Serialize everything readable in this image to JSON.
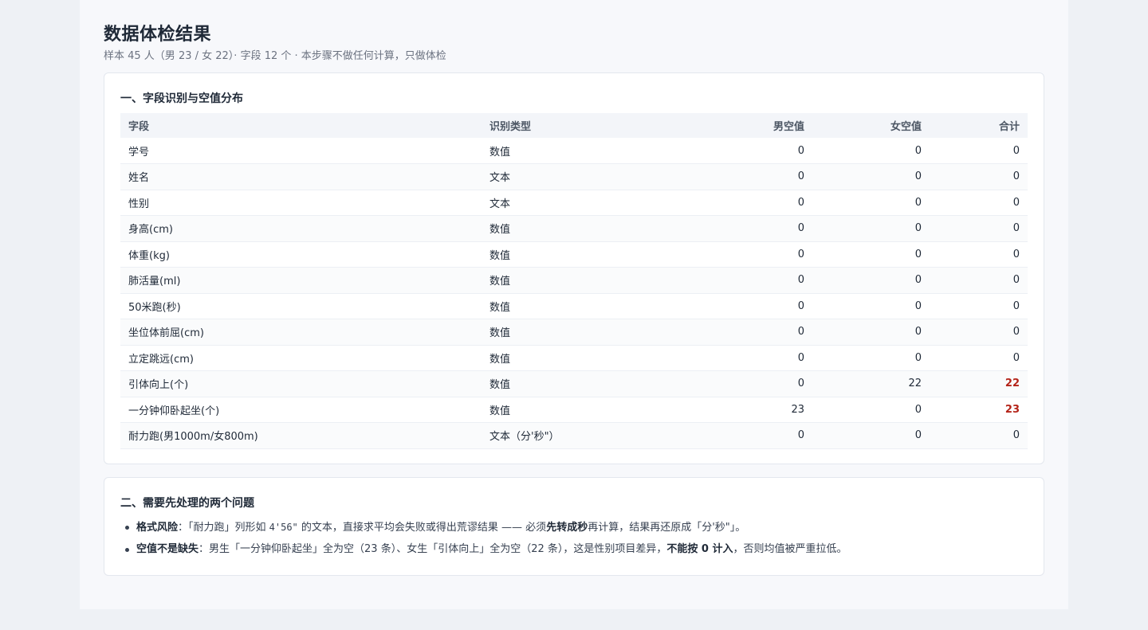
{
  "header": {
    "title": "数据体检结果",
    "subtitle": "样本 45 人（男 23 / 女 22）· 字段 12 个 · 本步骤不做任何计算，只做体检"
  },
  "section1": {
    "title": "一、字段识别与空值分布",
    "columns": [
      "字段",
      "识别类型",
      "男空值",
      "女空值",
      "合计"
    ],
    "rows": [
      {
        "field": "学号",
        "type": "数值",
        "male": "0",
        "female": "0",
        "total": "0"
      },
      {
        "field": "姓名",
        "type": "文本",
        "male": "0",
        "female": "0",
        "total": "0"
      },
      {
        "field": "性别",
        "type": "文本",
        "male": "0",
        "female": "0",
        "total": "0"
      },
      {
        "field": "身高(cm)",
        "type": "数值",
        "male": "0",
        "female": "0",
        "total": "0"
      },
      {
        "field": "体重(kg)",
        "type": "数值",
        "male": "0",
        "female": "0",
        "total": "0"
      },
      {
        "field": "肺活量(ml)",
        "type": "数值",
        "male": "0",
        "female": "0",
        "total": "0"
      },
      {
        "field": "50米跑(秒)",
        "type": "数值",
        "male": "0",
        "female": "0",
        "total": "0"
      },
      {
        "field": "坐位体前屈(cm)",
        "type": "数值",
        "male": "0",
        "female": "0",
        "total": "0"
      },
      {
        "field": "立定跳远(cm)",
        "type": "数值",
        "male": "0",
        "female": "0",
        "total": "0"
      },
      {
        "field": "引体向上(个)",
        "type": "数值",
        "male": "0",
        "female": "22",
        "total": "22",
        "highlight": true
      },
      {
        "field": "一分钟仰卧起坐(个)",
        "type": "数值",
        "male": "23",
        "female": "0",
        "total": "23",
        "highlight": true
      },
      {
        "field": "耐力跑(男1000m/女800m)",
        "type": "文本（分'秒\"）",
        "male": "0",
        "female": "0",
        "total": "0"
      }
    ],
    "highlight_color": "#b42318"
  },
  "section2": {
    "title": "二、需要先处理的两个问题",
    "issues": [
      {
        "label": "格式风险",
        "parts": [
          "：「耐力跑」列形如 ",
          "4'56\"",
          " 的文本，直接求平均会失败或得出荒谬结果 —— 必须",
          "先转成秒",
          "再计算，结果再还原成「分'秒\"」。"
        ]
      },
      {
        "label": "空值不是缺失",
        "parts": [
          "：男生「一分钟仰卧起坐」全为空（23 条）、女生「引体向上」全为空（22 条），这是性别项目差异，",
          "不能按 0 计入",
          "，否则均值被严重拉低。"
        ]
      }
    ]
  }
}
